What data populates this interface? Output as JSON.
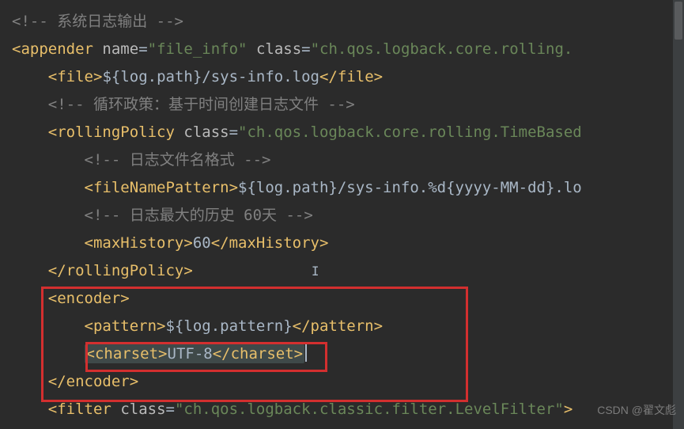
{
  "code": {
    "l1": "<!-- 系统日志输出 -->",
    "l2_open": "<",
    "l2_tag": "appender",
    "l2_sp": " ",
    "l2_attr1n": "name",
    "l2_attr1e": "=",
    "l2_attr1v": "\"file_info\"",
    "l2_sp2": " ",
    "l2_attr2n": "class",
    "l2_attr2e": "=",
    "l2_attr2v": "\"ch.qos.logback.core.rolling.",
    "l3_pre": "    ",
    "l3_o": "<",
    "l3_t": "file",
    "l3_c": ">",
    "l3_txt": "${log.path}/sys-info.log",
    "l3_co": "</",
    "l3_ct": "file",
    "l3_cc": ">",
    "l4_pre": "    ",
    "l4": "<!-- 循环政策：基于时间创建日志文件 -->",
    "l5_pre": "    ",
    "l5_o": "<",
    "l5_t": "rollingPolicy",
    "l5_sp": " ",
    "l5_an": "class",
    "l5_ae": "=",
    "l5_av": "\"ch.qos.logback.core.rolling.TimeBased",
    "l6_pre": "        ",
    "l6": "<!-- 日志文件名格式 -->",
    "l7_pre": "        ",
    "l7_o": "<",
    "l7_t": "fileNamePattern",
    "l7_c": ">",
    "l7_txt": "${log.path}/sys-info.%d{yyyy-MM-dd}.lo",
    "l8_pre": "        ",
    "l8": "<!-- 日志最大的历史 60天 -->",
    "l9_pre": "        ",
    "l9_o": "<",
    "l9_t": "maxHistory",
    "l9_c": ">",
    "l9_txt": "60",
    "l9_co": "</",
    "l9_ct": "maxHistory",
    "l9_cc": ">",
    "l10_pre": "    ",
    "l10_co": "</",
    "l10_t": "rollingPolicy",
    "l10_cc": ">",
    "l11_pre": "    ",
    "l11_o": "<",
    "l11_t": "encoder",
    "l11_c": ">",
    "l12_pre": "        ",
    "l12_o": "<",
    "l12_t": "pattern",
    "l12_c": ">",
    "l12_txt": "${log.pattern}",
    "l12_co": "</",
    "l12_ct": "pattern",
    "l12_cc": ">",
    "l13_pre": "        ",
    "l13_o": "<",
    "l13_t": "charset",
    "l13_c": ">",
    "l13_txt": "UTF-8",
    "l13_co": "</",
    "l13_ct": "charset",
    "l13_cc": ">",
    "l14_pre": "    ",
    "l14_co": "</",
    "l14_t": "encoder",
    "l14_cc": ">",
    "l15_pre": "    ",
    "l15_o": "<",
    "l15_t": "filter",
    "l15_sp": " ",
    "l15_an": "class",
    "l15_ae": "=",
    "l15_av": "\"ch.qos.logback.classic.filter.LevelFilter\"",
    "l15_c": ">"
  },
  "watermark": "CSDN @翟文彪"
}
